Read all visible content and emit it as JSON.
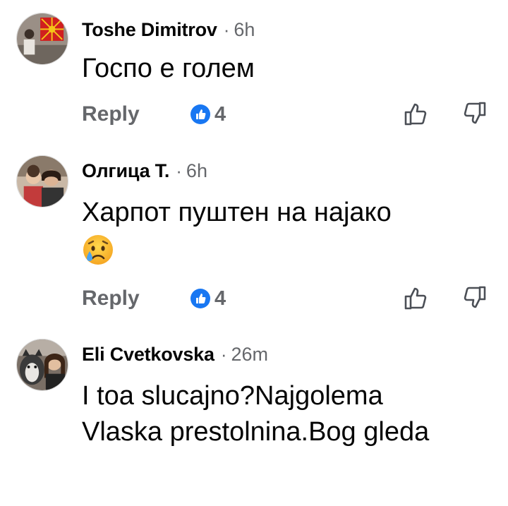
{
  "comments": [
    {
      "author": "Toshe Dimitrov",
      "separator": "·",
      "time": "6h",
      "text": "Госпо е голем",
      "reply_label": "Reply",
      "reaction_count": "4",
      "avatar_icon": "user-avatar-flag"
    },
    {
      "author": "Олгица Т.",
      "separator": "·",
      "time": "6h",
      "text": "Харпот пуштен на најако",
      "emoji": "crying-face-emoji",
      "reply_label": "Reply",
      "reaction_count": "4",
      "avatar_icon": "user-avatar-photo"
    },
    {
      "author": "Eli Cvetkovska",
      "separator": "·",
      "time": "26m",
      "text": "I toa slucajno?Najgolema Vlaska prestolnina.Bog gleda",
      "avatar_icon": "user-avatar-husky"
    }
  ],
  "colors": {
    "like_blue": "#1877f2",
    "meta_gray": "#65676b",
    "text_black": "#050505"
  }
}
